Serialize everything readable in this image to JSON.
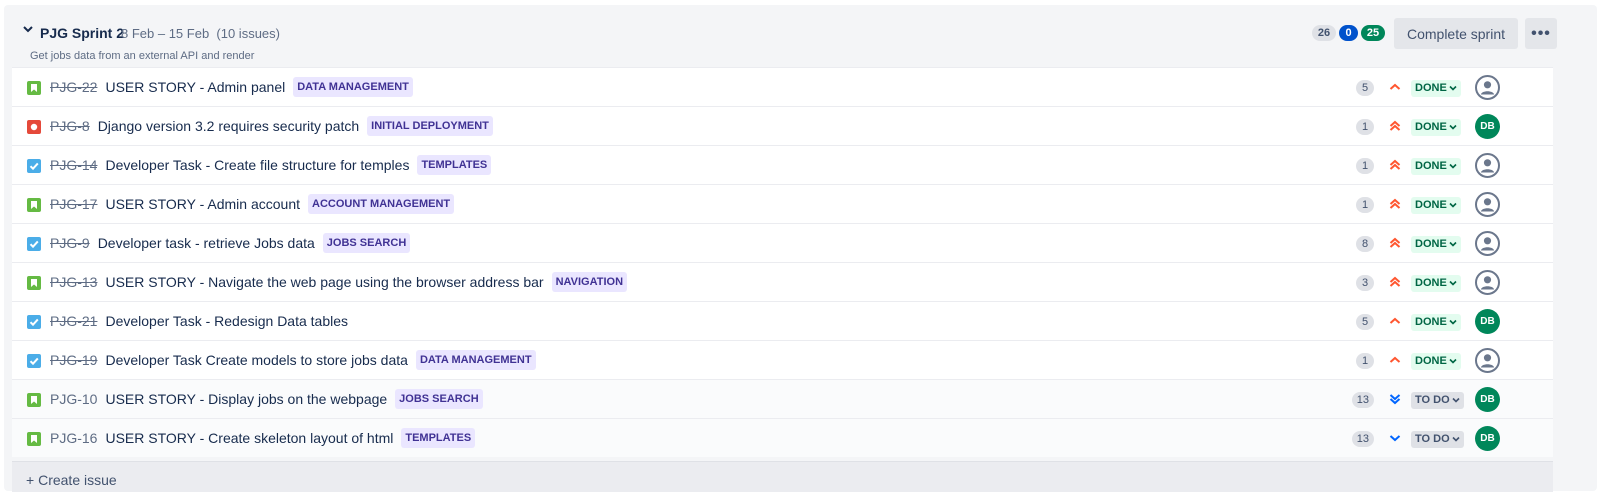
{
  "sprint": {
    "name": "PJG Sprint 2",
    "dates": "8 Feb – 15 Feb",
    "issue_count": "(10 issues)",
    "goal": "Get jobs data from an external API and render",
    "counts": {
      "todo": "26",
      "in_progress": "0",
      "done": "25"
    },
    "complete_label": "Complete sprint",
    "more_label": "•••"
  },
  "issues": [
    {
      "key": "PJG-22",
      "summary": "USER STORY - Admin panel",
      "epic": "DATA MANAGEMENT",
      "estimate": "5",
      "status": "DONE",
      "type": "story",
      "priority": "medium",
      "assignee": "unassigned"
    },
    {
      "key": "PJG-8",
      "summary": "Django version 3.2 requires security patch",
      "epic": "INITIAL DEPLOYMENT",
      "estimate": "1",
      "status": "DONE",
      "type": "bug",
      "priority": "high",
      "assignee": "DB"
    },
    {
      "key": "PJG-14",
      "summary": "Developer Task - Create file structure for temples",
      "epic": "TEMPLATES",
      "estimate": "1",
      "status": "DONE",
      "type": "task",
      "priority": "high",
      "assignee": "unassigned"
    },
    {
      "key": "PJG-17",
      "summary": "USER STORY - Admin account",
      "epic": "ACCOUNT MANAGEMENT",
      "estimate": "1",
      "status": "DONE",
      "type": "story",
      "priority": "high",
      "assignee": "unassigned"
    },
    {
      "key": "PJG-9",
      "summary": "Developer task - retrieve Jobs data",
      "epic": "JOBS SEARCH",
      "estimate": "8",
      "status": "DONE",
      "type": "task",
      "priority": "high",
      "assignee": "unassigned"
    },
    {
      "key": "PJG-13",
      "summary": "USER STORY - Navigate the web page using the browser address bar",
      "epic": "NAVIGATION",
      "estimate": "3",
      "status": "DONE",
      "type": "story",
      "priority": "high",
      "assignee": "unassigned"
    },
    {
      "key": "PJG-21",
      "summary": "Developer Task - Redesign Data tables",
      "epic": "",
      "estimate": "5",
      "status": "DONE",
      "type": "task",
      "priority": "medium",
      "assignee": "DB"
    },
    {
      "key": "PJG-19",
      "summary": "Developer Task Create models to store jobs data",
      "epic": "DATA MANAGEMENT",
      "estimate": "1",
      "status": "DONE",
      "type": "task",
      "priority": "medium",
      "assignee": "unassigned"
    },
    {
      "key": "PJG-10",
      "summary": "USER STORY - Display jobs on the webpage",
      "epic": "JOBS SEARCH",
      "estimate": "13",
      "status": "TO DO",
      "type": "story",
      "priority": "lowest",
      "assignee": "DB"
    },
    {
      "key": "PJG-16",
      "summary": "USER STORY - Create skeleton layout of html",
      "epic": "TEMPLATES",
      "estimate": "13",
      "status": "TO DO",
      "type": "story",
      "priority": "low",
      "assignee": "DB"
    }
  ],
  "create_issue": {
    "label": "Create issue",
    "icon": "plus-icon"
  },
  "colors": {
    "story": "#65ba43",
    "bug": "#e5493a",
    "task": "#4bade8",
    "priority_high": "#ff5630",
    "priority_low": "#0065ff",
    "done_badge": "#e3fcef",
    "epic_badge": "#eae6ff",
    "avatar": "#00875a"
  }
}
